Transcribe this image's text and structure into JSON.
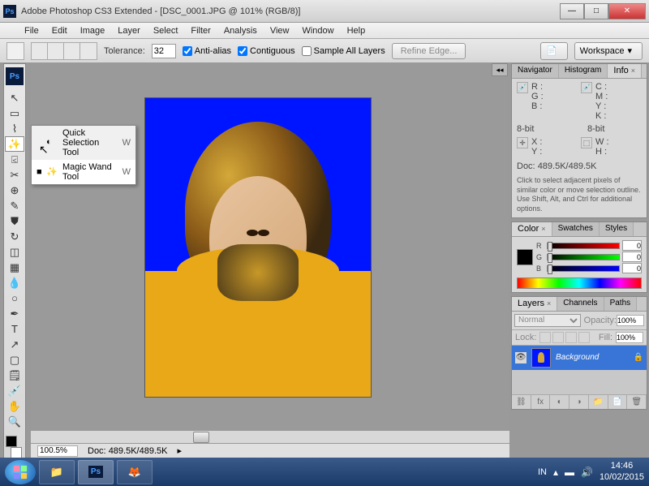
{
  "title": "Adobe Photoshop CS3 Extended - [DSC_0001.JPG @ 101% (RGB/8)]",
  "menu": [
    "File",
    "Edit",
    "Image",
    "Layer",
    "Select",
    "Filter",
    "Analysis",
    "View",
    "Window",
    "Help"
  ],
  "options": {
    "tolerance_label": "Tolerance:",
    "tolerance_value": "32",
    "antialias": "Anti-alias",
    "contiguous": "Contiguous",
    "sample_all": "Sample All Layers",
    "refine": "Refine Edge...",
    "workspace": "Workspace"
  },
  "flyout": {
    "items": [
      {
        "bullet": "",
        "label": "Quick Selection Tool",
        "key": "W"
      },
      {
        "bullet": "■",
        "label": "Magic Wand Tool",
        "key": "W"
      }
    ]
  },
  "status": {
    "zoom": "100.5%",
    "doc_label": "Doc:",
    "doc": "489.5K/489.5K"
  },
  "info_panel": {
    "tabs": [
      "Navigator",
      "Histogram",
      "Info"
    ],
    "r": "R :",
    "g": "G :",
    "b": "B :",
    "c": "C :",
    "m": "M :",
    "y": "Y :",
    "k": "K :",
    "bit": "8-bit",
    "x": "X :",
    "yy": "Y :",
    "w": "W :",
    "h": "H :",
    "doc_label": "Doc:",
    "doc": "489.5K/489.5K",
    "hint": "Click to select adjacent pixels of similar color or move selection outline. Use Shift, Alt, and Ctrl for additional options."
  },
  "color_panel": {
    "tabs": [
      "Color",
      "Swatches",
      "Styles"
    ],
    "r": "R",
    "g": "G",
    "b": "B",
    "rv": "0",
    "gv": "0",
    "bv": "0"
  },
  "layers_panel": {
    "tabs": [
      "Layers",
      "Channels",
      "Paths"
    ],
    "mode": "Normal",
    "opacity_label": "Opacity:",
    "opacity": "100%",
    "lock_label": "Lock:",
    "fill_label": "Fill:",
    "fill": "100%",
    "layer_name": "Background"
  },
  "taskbar": {
    "lang": "IN",
    "time": "14:46",
    "date": "10/02/2015"
  }
}
